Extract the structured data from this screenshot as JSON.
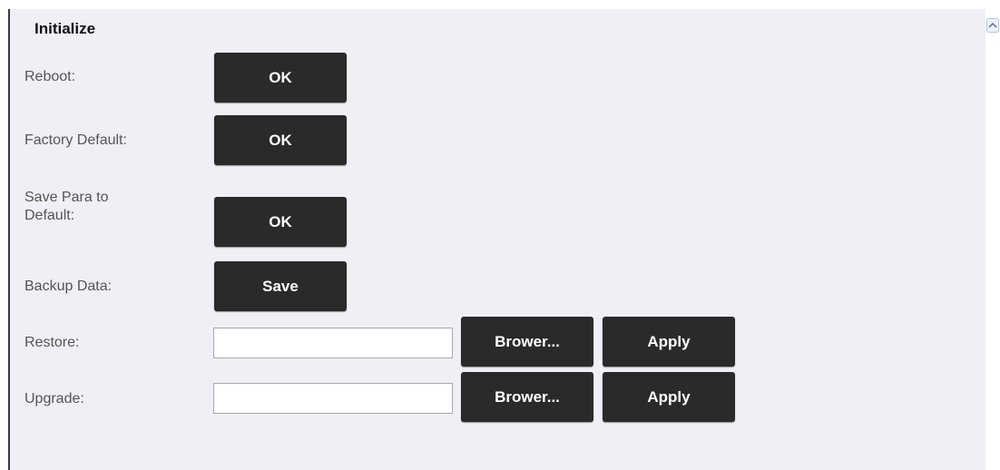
{
  "section": {
    "title": "Initialize"
  },
  "rows": {
    "reboot": {
      "label": "Reboot:",
      "button": "OK"
    },
    "factory_default": {
      "label": "Factory Default:",
      "button": "OK"
    },
    "save_para": {
      "label_line1": "Save Para to",
      "label_line2": "Default:",
      "button": "OK"
    },
    "backup": {
      "label": "Backup Data:",
      "button": "Save"
    },
    "restore": {
      "label": "Restore:",
      "value": "",
      "browse": "Brower...",
      "apply": "Apply"
    },
    "upgrade": {
      "label": "Upgrade:",
      "value": "",
      "browse": "Brower...",
      "apply": "Apply"
    }
  },
  "colors": {
    "panel_bg": "#eef0f5",
    "button_bg": "#2a2a2a",
    "button_text": "#ffffff",
    "label_text": "#555555"
  },
  "icons": {
    "scroll_up": "chevron-up-icon"
  }
}
